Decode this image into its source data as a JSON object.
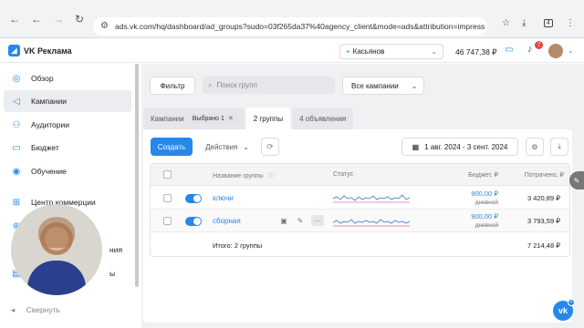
{
  "browser": {
    "url": "ads.vk.com/hq/dashboard/ad_groups?sudo=03f265da37%40agency_client&mode=ads&attribution=impress",
    "tab_count": "4"
  },
  "topbar": {
    "logo_text": "VK Реклама",
    "account_name": "Касьянов",
    "balance": "46 747,38 ₽",
    "notifications": "7"
  },
  "sidebar": {
    "items": [
      {
        "label": "Обзор",
        "icon": "compass-icon"
      },
      {
        "label": "Кампании",
        "icon": "megaphone-icon"
      },
      {
        "label": "Аудитории",
        "icon": "users-icon"
      },
      {
        "label": "Бюджет",
        "icon": "wallet-icon"
      },
      {
        "label": "Обучение",
        "icon": "graduation-cap-icon"
      },
      {
        "label": "Центр коммерции",
        "icon": "cart-icon"
      },
      {
        "label": "",
        "icon": "globe-icon"
      },
      {
        "label": "ния",
        "icon": "plug-icon"
      },
      {
        "label": "ы",
        "icon": "document-icon"
      }
    ],
    "collapse_label": "Свернуть"
  },
  "toolbar": {
    "filter_label": "Фильтр",
    "search_placeholder": "Поиск групп",
    "campaigns_select": "Все кампании"
  },
  "tabs": [
    {
      "label": "Кампании",
      "chip": "Выбрано 1"
    },
    {
      "label": "2 группы"
    },
    {
      "label": "4 объявления"
    }
  ],
  "actions": {
    "create_label": "Создать",
    "actions_label": "Действия",
    "date_range": "1 авг. 2024 - 3 сент. 2024"
  },
  "table": {
    "headers": {
      "name": "Название группы",
      "status": "Статус",
      "budget": "Бюджет, ₽",
      "spent": "Потрачено, ₽"
    },
    "rows": [
      {
        "name": "ключи",
        "budget": "900,00 ₽",
        "period": "дневной",
        "spent": "3 420,89 ₽",
        "enabled": true
      },
      {
        "name": "сборная",
        "budget": "900,00 ₽",
        "period": "дневной",
        "spent": "3 793,59 ₽",
        "enabled": true
      }
    ],
    "total_label": "Итого: 2 группы",
    "total_spent": "7 214,48 ₽"
  },
  "colors": {
    "accent": "#2688eb",
    "sidebar_active": "#ecedf0",
    "background": "#f0f1f3"
  }
}
